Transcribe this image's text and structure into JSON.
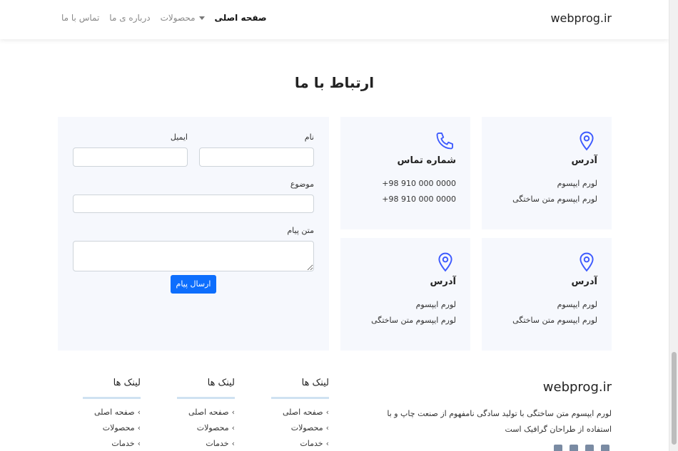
{
  "navbar": {
    "brand": "webprog.ir",
    "items": [
      {
        "label": "صفحه اصلی",
        "active": true
      },
      {
        "label": "محصولات",
        "dropdown": true
      },
      {
        "label": "درباره ی ما"
      },
      {
        "label": "تماس با ما"
      }
    ]
  },
  "page": {
    "title": "ارتباط با ما"
  },
  "cards": [
    {
      "icon": "map-pin-icon",
      "title": "آدرس",
      "line1": "لورم ایپسوم",
      "line2": "لورم ایپسوم متن ساختگی"
    },
    {
      "icon": "phone-icon",
      "title": "شماره تماس",
      "line1": "+98 910 000 0000",
      "line2": "+98 910 000 0000"
    },
    {
      "icon": "map-pin-icon",
      "title": "آدرس",
      "line1": "لورم ایپسوم",
      "line2": "لورم ایپسوم متن ساختگی"
    },
    {
      "icon": "map-pin-icon",
      "title": "آدرس",
      "line1": "لورم ایپسوم",
      "line2": "لورم ایپسوم متن ساختگی"
    }
  ],
  "form": {
    "name_label": "نام",
    "email_label": "ایمیل",
    "subject_label": "موضوع",
    "message_label": "متن پیام",
    "submit_label": "ارسال پیام",
    "name_value": "",
    "email_value": "",
    "subject_value": "",
    "message_value": ""
  },
  "footer": {
    "brand": "webprog.ir",
    "desc_line1": "لورم ایپسوم متن ساختگی با تولید سادگی نامفهوم از صنعت چاپ و با",
    "desc_line2": "استفاده از طراحان گرافیک است",
    "columns": [
      {
        "title": "لینک ها",
        "links": [
          "صفحه اصلی",
          "محصولات",
          "خدمات"
        ]
      },
      {
        "title": "لینک ها",
        "links": [
          "صفحه اصلی",
          "محصولات",
          "خدمات"
        ]
      },
      {
        "title": "لینک ها",
        "links": [
          "صفحه اصلی",
          "محصولات",
          "خدمات"
        ]
      }
    ]
  },
  "colors": {
    "accent": "#0d6efd",
    "icon": "#3d5afe",
    "card_bg": "#f6f8fd"
  }
}
